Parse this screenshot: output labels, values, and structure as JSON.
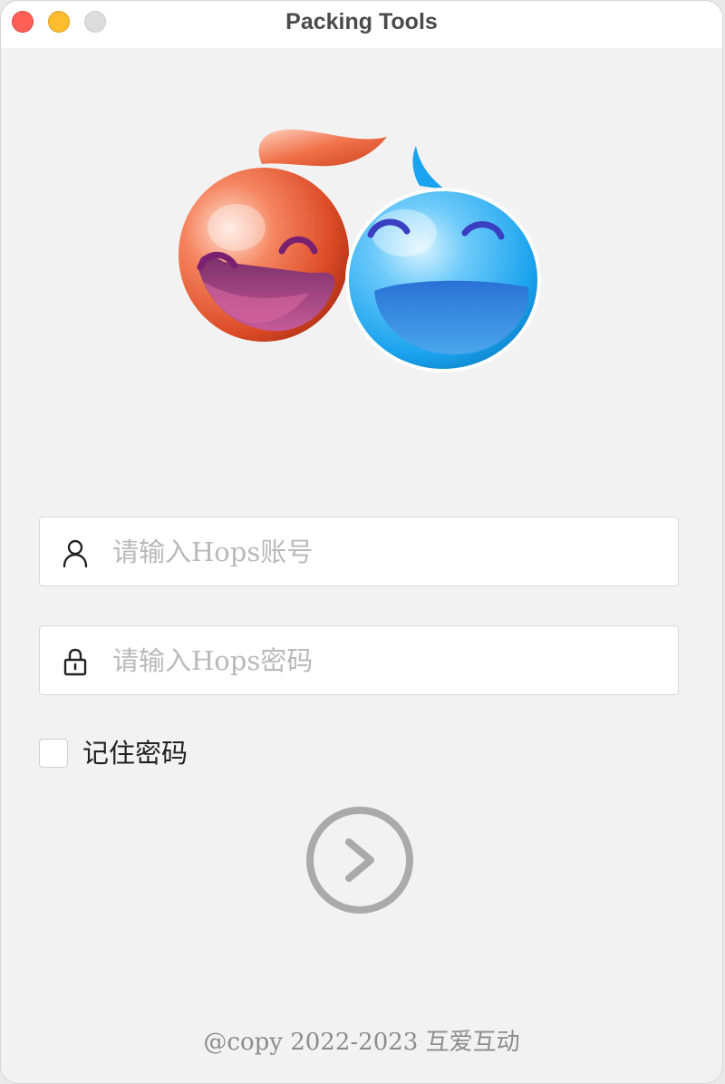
{
  "window": {
    "title": "Packing Tools",
    "controls": [
      "close",
      "minimize",
      "zoom"
    ]
  },
  "logo": {
    "icons": [
      "orange-smiley-icon",
      "blue-smiley-icon"
    ]
  },
  "form": {
    "account": {
      "icon": "user-icon",
      "placeholder": "请输入Hops账号",
      "value": ""
    },
    "password": {
      "icon": "lock-icon",
      "placeholder": "请输入Hops密码",
      "value": ""
    },
    "remember": {
      "label": "记住密码",
      "checked": false
    },
    "submit": {
      "icon": "arrow-right-circle-icon"
    }
  },
  "footer": {
    "copyright": "@copy 2022-2023 互爱互动"
  },
  "colors": {
    "background": "#f2f2f2",
    "titlebar": "#ffffff",
    "close": "#fe5f57",
    "minimize": "#febc2e",
    "zoom_disabled": "#dcdcdc",
    "placeholder": "#b9b9b9",
    "button": "#aaaaaa",
    "footer_text": "#8c8c8c"
  }
}
